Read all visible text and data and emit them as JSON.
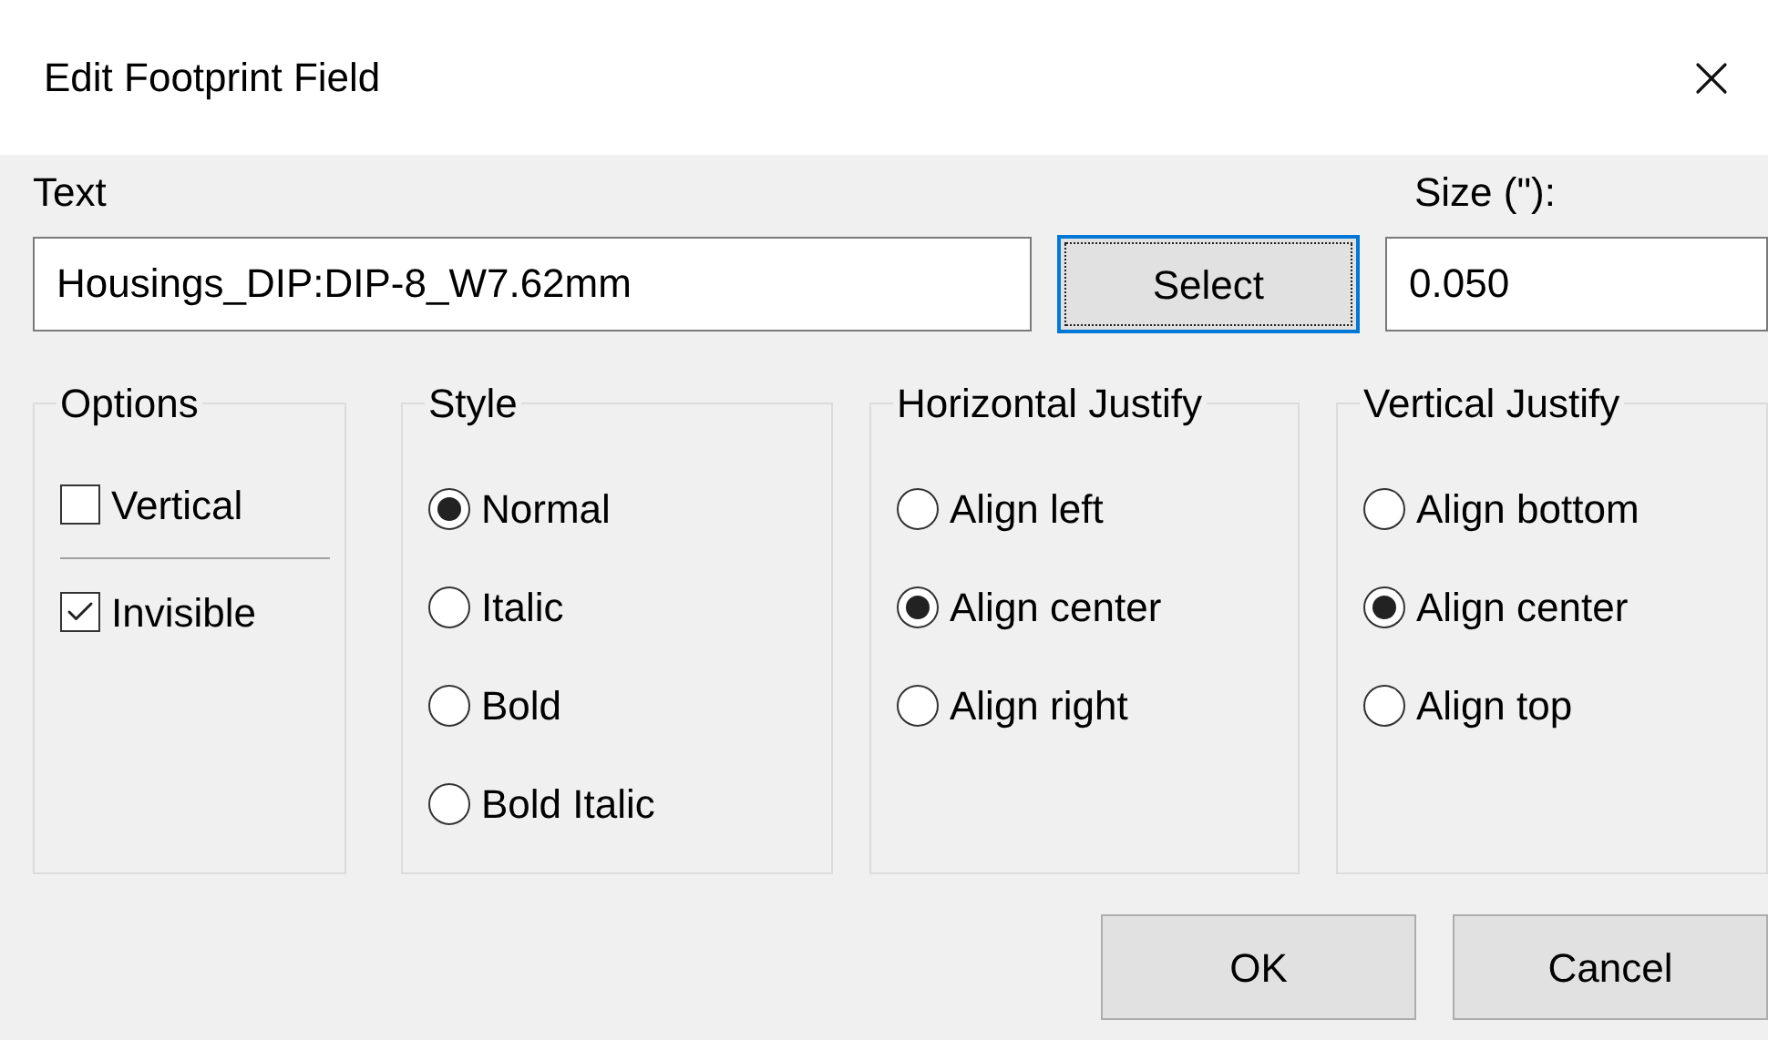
{
  "window": {
    "title": "Edit Footprint Field"
  },
  "text_field": {
    "label": "Text",
    "value": "Housings_DIP:DIP-8_W7.62mm"
  },
  "select_button": {
    "label": "Select",
    "focused": true
  },
  "size_field": {
    "label": "Size (\"):",
    "value": "0.050"
  },
  "groups": [
    {
      "title": "Options",
      "items": [
        {
          "kind": "checkbox",
          "label": "Vertical",
          "checked": false
        },
        {
          "kind": "separator"
        },
        {
          "kind": "checkbox",
          "label": "Invisible",
          "checked": true
        }
      ]
    },
    {
      "title": "Style",
      "items": [
        {
          "kind": "radio",
          "label": "Normal",
          "selected": true
        },
        {
          "kind": "radio",
          "label": "Italic",
          "selected": false
        },
        {
          "kind": "radio",
          "label": "Bold",
          "selected": false
        },
        {
          "kind": "radio",
          "label": "Bold Italic",
          "selected": false
        }
      ]
    },
    {
      "title": "Horizontal Justify",
      "items": [
        {
          "kind": "radio",
          "label": "Align left",
          "selected": false
        },
        {
          "kind": "radio",
          "label": "Align center",
          "selected": true
        },
        {
          "kind": "radio",
          "label": "Align right",
          "selected": false
        }
      ]
    },
    {
      "title": "Vertical Justify",
      "items": [
        {
          "kind": "radio",
          "label": "Align bottom",
          "selected": false
        },
        {
          "kind": "radio",
          "label": "Align center",
          "selected": true
        },
        {
          "kind": "radio",
          "label": "Align top",
          "selected": false
        }
      ]
    }
  ],
  "buttons": [
    {
      "label": "OK"
    },
    {
      "label": "Cancel"
    }
  ]
}
